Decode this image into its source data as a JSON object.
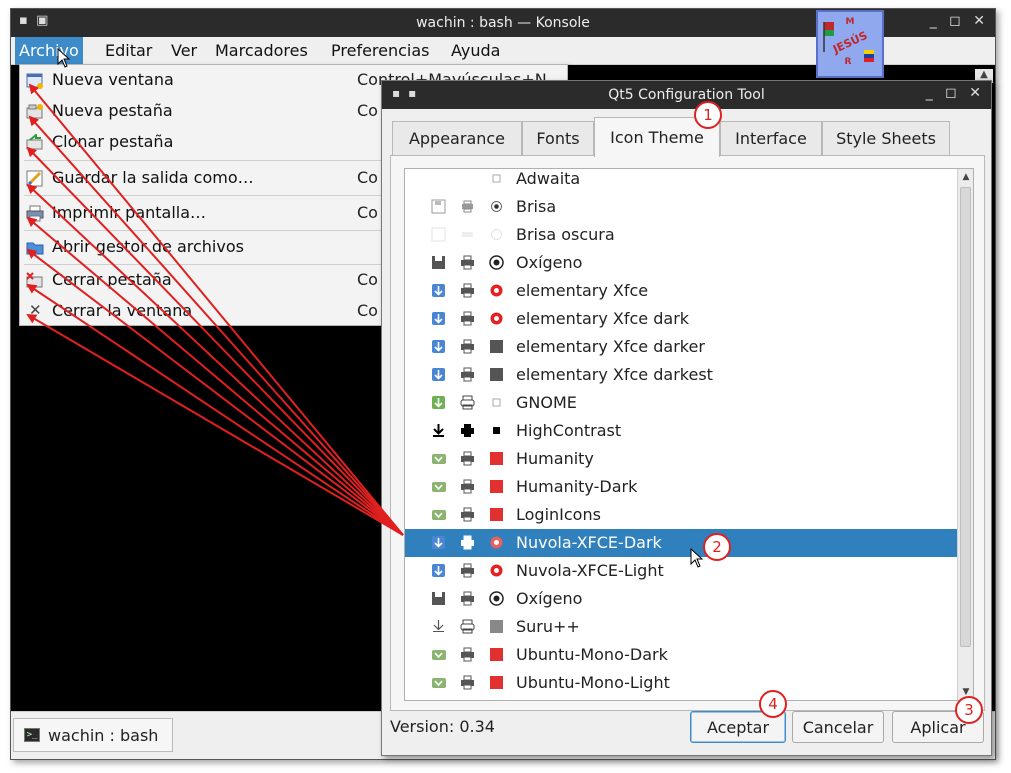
{
  "konsole": {
    "title": "wachin : bash — Konsole",
    "window_buttons": "_ ◻ ✕",
    "menu": [
      "Archivo",
      "Editar",
      "Ver",
      "Marcadores",
      "Preferencias",
      "Ayuda"
    ],
    "active_menu": "Archivo",
    "bottom_tab": "wachin : bash"
  },
  "file_menu": {
    "items": [
      {
        "label": "Nueva ventana",
        "shortcut": "Control+Mayúsculas+N",
        "icon": "new-window-icon"
      },
      {
        "label": "Nueva pestaña",
        "shortcut": "Co",
        "icon": "new-tab-icon"
      },
      {
        "label": "Clonar pestaña",
        "shortcut": "",
        "icon": "clone-tab-icon"
      },
      {
        "label": "Guardar la salida como…",
        "shortcut": "Co",
        "icon": "save-output-icon"
      },
      {
        "label": "Imprimir pantalla…",
        "shortcut": "Co",
        "icon": "print-icon"
      },
      {
        "label": "Abrir gestor de archivos",
        "shortcut": "",
        "icon": "folder-icon"
      },
      {
        "label": "Cerrar pestaña",
        "shortcut": "Co",
        "icon": "close-tab-icon"
      },
      {
        "label": "Cerrar la ventana",
        "shortcut": "Co",
        "icon": "close-icon"
      }
    ]
  },
  "qtct": {
    "title": "Qt5 Configuration Tool",
    "window_buttons": "_ ◻ ✕",
    "tabs": [
      "Appearance",
      "Fonts",
      "Icon Theme",
      "Interface",
      "Style Sheets"
    ],
    "active_tab": "Icon Theme",
    "themes": [
      {
        "name": "Adwaita",
        "style": "adwaita"
      },
      {
        "name": "Brisa",
        "style": "brisa"
      },
      {
        "name": "Brisa oscura",
        "style": "brisa-faded"
      },
      {
        "name": "Oxígeno",
        "style": "oxygen"
      },
      {
        "name": "elementary Xfce",
        "style": "elem-red"
      },
      {
        "name": "elementary Xfce dark",
        "style": "elem-red"
      },
      {
        "name": "elementary Xfce darker",
        "style": "elem-dark"
      },
      {
        "name": "elementary Xfce darkest",
        "style": "elem-dark"
      },
      {
        "name": "GNOME",
        "style": "gnome"
      },
      {
        "name": "HighContrast",
        "style": "hc"
      },
      {
        "name": "Humanity",
        "style": "humanity"
      },
      {
        "name": "Humanity-Dark",
        "style": "humanity"
      },
      {
        "name": "LoginIcons",
        "style": "humanity"
      },
      {
        "name": "Nuvola-XFCE-Dark",
        "style": "nuvola",
        "selected": true
      },
      {
        "name": "Nuvola-XFCE-Light",
        "style": "elem-red"
      },
      {
        "name": "Oxígeno",
        "style": "oxygen"
      },
      {
        "name": "Suru++",
        "style": "suru"
      },
      {
        "name": "Ubuntu-Mono-Dark",
        "style": "humanity"
      },
      {
        "name": "Ubuntu-Mono-Light",
        "style": "humanity"
      }
    ],
    "version": "Version: 0.34",
    "buttons": {
      "accept": "Aceptar",
      "cancel": "Cancelar",
      "apply": "Aplicar"
    }
  },
  "annotations": [
    "1",
    "2",
    "3",
    "4"
  ],
  "logo_text": "JESÚS"
}
